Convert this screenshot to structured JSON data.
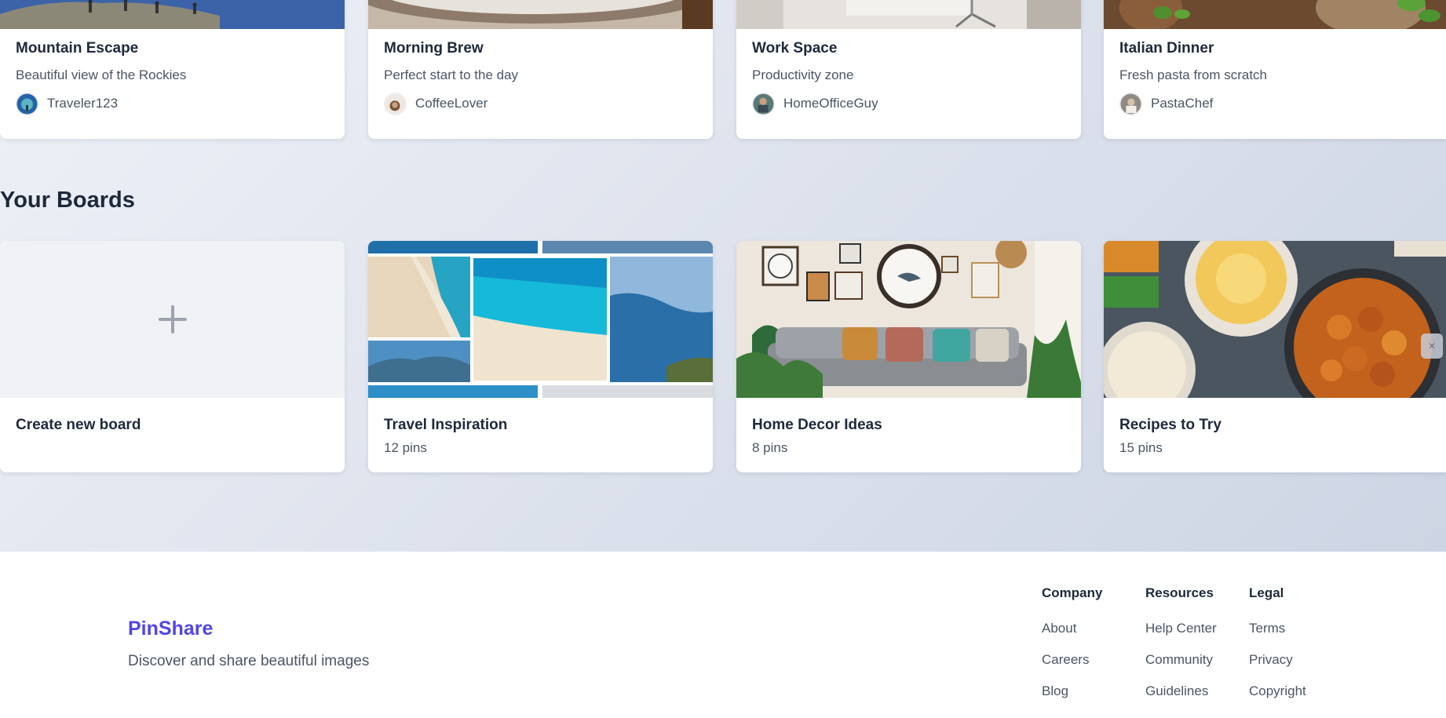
{
  "pins": [
    {
      "title": "Mountain Escape",
      "description": "Beautiful view of the Rockies",
      "author": "Traveler123",
      "image_icon": "mountain-hikers-photo"
    },
    {
      "title": "Morning Brew",
      "description": "Perfect start to the day",
      "author": "CoffeeLover",
      "image_icon": "coffee-cup-photo"
    },
    {
      "title": "Work Space",
      "description": "Productivity zone",
      "author": "HomeOfficeGuy",
      "image_icon": "office-chair-photo"
    },
    {
      "title": "Italian Dinner",
      "description": "Fresh pasta from scratch",
      "author": "PastaChef",
      "image_icon": "basil-pasta-photo"
    }
  ],
  "boards_section": {
    "title": "Your Boards",
    "create_label": "Create new board",
    "boards": [
      {
        "title": "Travel Inspiration",
        "count": "12 pins",
        "cover_icon": "beach-collage-photo"
      },
      {
        "title": "Home Decor Ideas",
        "count": "8 pins",
        "cover_icon": "living-room-photo"
      },
      {
        "title": "Recipes to Try",
        "count": "15 pins",
        "cover_icon": "food-bowls-photo"
      }
    ]
  },
  "footer": {
    "brand": "PinShare",
    "tagline": "Discover and share beautiful images",
    "columns": [
      {
        "heading": "Company",
        "links": [
          "About",
          "Careers",
          "Blog"
        ]
      },
      {
        "heading": "Resources",
        "links": [
          "Help Center",
          "Community",
          "Guidelines"
        ]
      },
      {
        "heading": "Legal",
        "links": [
          "Terms",
          "Privacy",
          "Copyright"
        ]
      }
    ]
  },
  "colors": {
    "brand": "#4f46e5",
    "text_dark": "#1e293b",
    "text_muted": "#4b5563"
  }
}
